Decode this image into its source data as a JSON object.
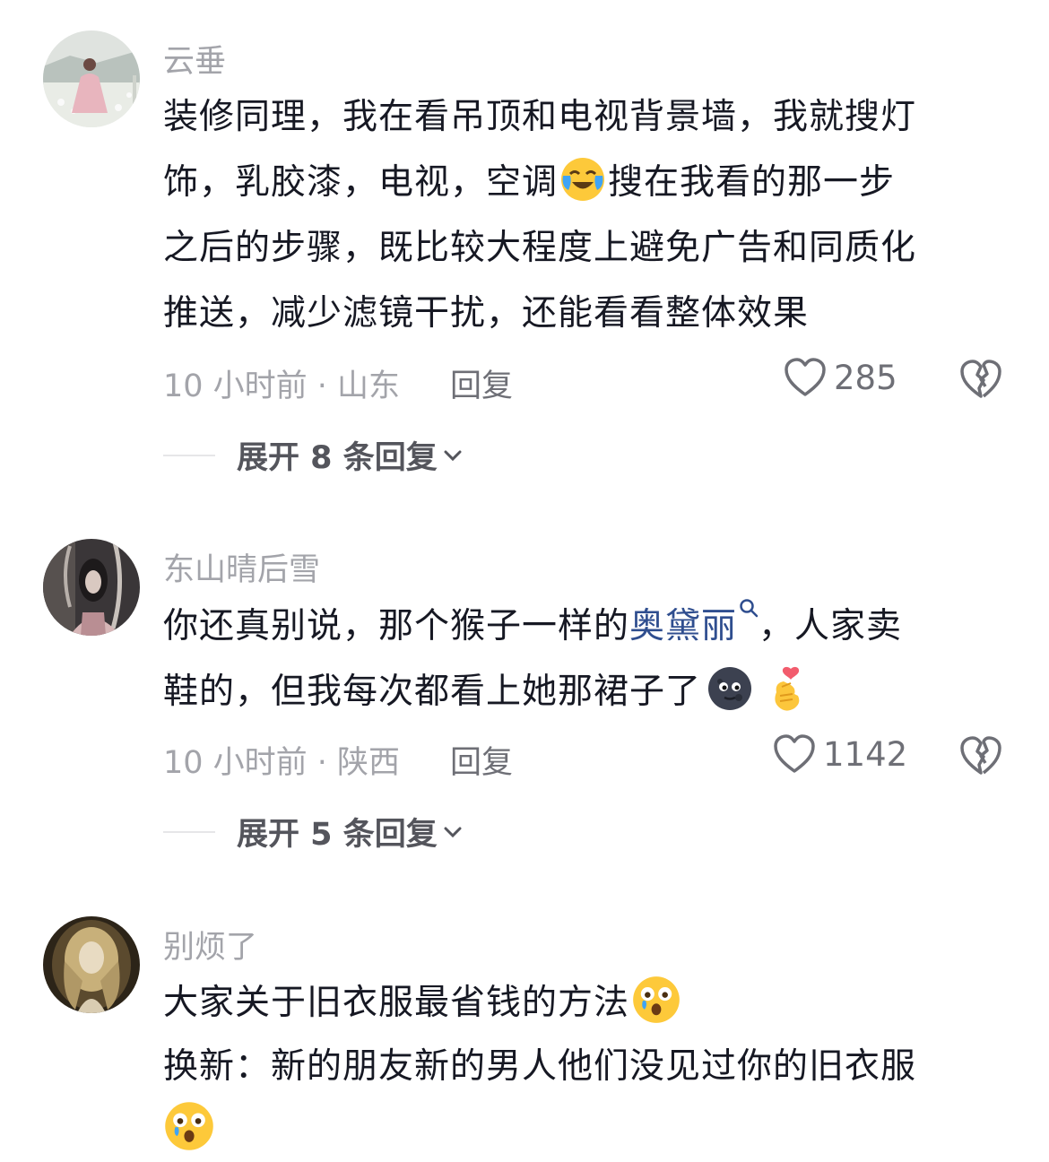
{
  "comments": [
    {
      "username": "云垂",
      "lines": [
        "装修同理，我在看吊顶和电视背景墙，我就搜灯",
        "饰，乳胶漆，电视，空调",
        "搜在我看的那一步",
        "之后的步骤，既比较大程度上避免广告和同质化",
        "推送，减少滤镜干扰，还能看看整体效果"
      ],
      "emoji_inline": "crying-laughing-emoji",
      "time_location": "10 小时前 · 山东",
      "reply_label": "回复",
      "likes": "285",
      "expand_label": "展开 8 条回复"
    },
    {
      "username": "东山晴后雪",
      "line1_a": "你还真别说，那个猴子一样的",
      "line1_link": "奥黛丽",
      "line1_b": "，人家卖",
      "line2": "鞋的，但我每次都看上她那裙子了",
      "emojis": [
        "dark-moon-face-emoji",
        "finger-heart-emoji"
      ],
      "time_location": "10 小时前 · 陕西",
      "reply_label": "回复",
      "likes": "1142",
      "expand_label": "展开 5 条回复"
    },
    {
      "username": "别烦了",
      "line1": "大家关于旧衣服最省钱的方法",
      "line2": "换新：新的朋友新的男人他们没见过你的旧衣服",
      "emojis": [
        "teary-shocked-emoji",
        "teary-shocked-emoji"
      ]
    }
  ],
  "colors": {
    "text": "#161823",
    "muted": "#a3a4aa",
    "link": "#2f4e8f"
  }
}
